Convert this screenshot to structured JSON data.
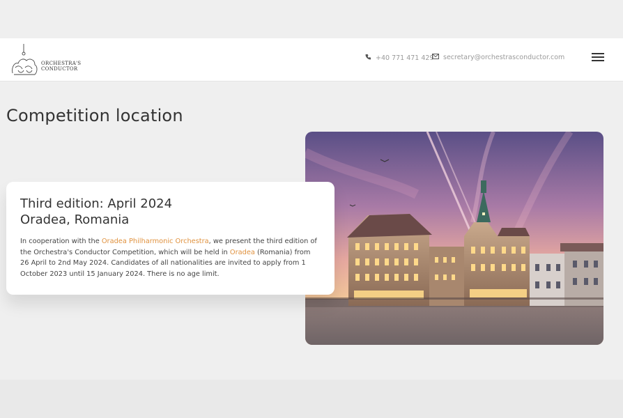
{
  "header": {
    "logo_line1": "ORCHESTRA'S",
    "logo_line2": "CONDUCTOR",
    "phone": "+40 771 471 429",
    "email": "secretary@orchestrasconductor.com"
  },
  "main": {
    "title": "Competition location",
    "card": {
      "heading_line1": "Third edition: April 2024",
      "heading_line2": "Oradea, Romania",
      "text_1": "In cooperation with the ",
      "link_orchestra": "Oradea Philharmonic Orchestra",
      "text_2": ", we present the third edition of the Orchestra's Conductor Competition, which will be held in ",
      "link_city": "Oradea",
      "text_3": " (Romania) from 26 April to 2nd May 2024. Candidates of all nationalities are invited to apply from 1 October 2023 until 15 January 2024. There is no age limit."
    }
  },
  "icons": {
    "phone": "phone-icon",
    "email": "envelope-icon",
    "menu": "hamburger-menu-icon"
  },
  "colors": {
    "link": "#e0923f",
    "header_bg": "#ffffff",
    "page_bg": "#efefef"
  }
}
